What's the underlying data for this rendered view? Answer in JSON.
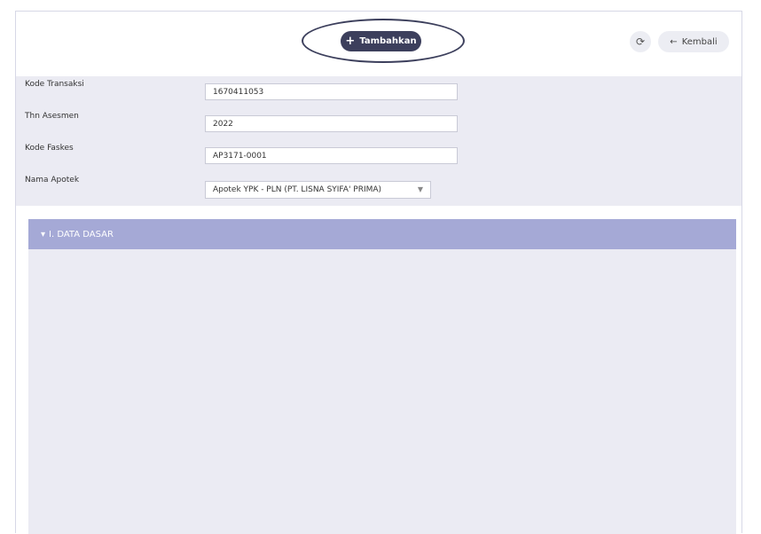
{
  "toolbar": {
    "add_label": "Tambahkan",
    "add_icon": "+",
    "refresh_icon": "⟳",
    "back_icon": "←",
    "back_label": "Kembali"
  },
  "form": {
    "kode_transaksi": {
      "label": "Kode Transaksi",
      "value": "1670411053"
    },
    "thn_asesmen": {
      "label": "Thn Asesmen",
      "value": "2022"
    },
    "kode_faskes": {
      "label": "Kode Faskes",
      "value": "AP3171-0001"
    },
    "nama_apotek": {
      "label": "Nama Apotek",
      "value": "Apotek YPK - PLN (PT. LISNA SYIFA' PRIMA)"
    }
  },
  "section": {
    "title": "I. DATA DASAR",
    "icon": "▾"
  },
  "colors": {
    "accent": "#3c3f5c",
    "section_header": "#a5a9d6",
    "panel": "#ebebf3"
  }
}
